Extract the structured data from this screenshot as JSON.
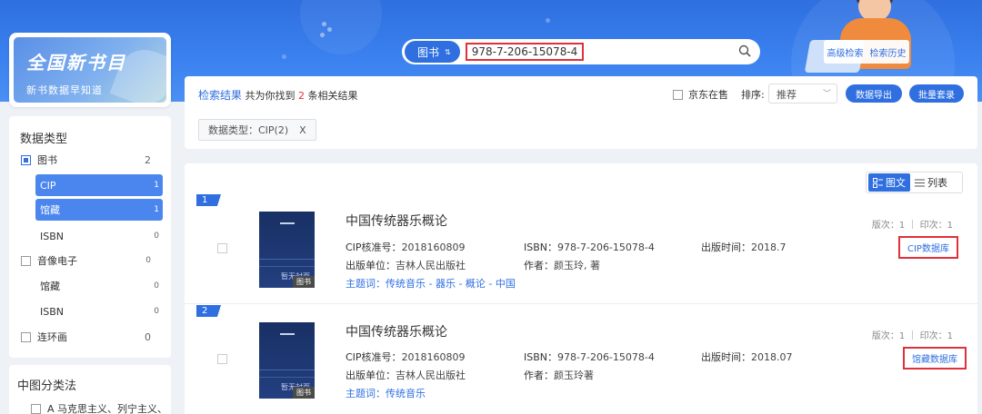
{
  "search": {
    "type_label": "图书",
    "type_arrows": "⇅",
    "query": "978-7-206-15078-4"
  },
  "top_links": {
    "advanced": "高级检索",
    "history": "检索历史"
  },
  "brand": {
    "title": "全国新书目",
    "subtitle": "新书数据早知道"
  },
  "data_type": {
    "heading": "数据类型",
    "rows": [
      {
        "label": "图书",
        "count": "2"
      },
      {
        "label": "CIP",
        "count": "1"
      },
      {
        "label": "馆藏",
        "count": "1"
      },
      {
        "label": "ISBN",
        "count": "0"
      },
      {
        "label": "音像电子",
        "count": "0"
      },
      {
        "label": "馆藏",
        "count": "0"
      },
      {
        "label": "ISBN",
        "count": "0"
      },
      {
        "label": "连环画",
        "count": "0"
      }
    ]
  },
  "classification": {
    "heading": "中图分类法",
    "first_item": "A 马克思主义、列宁主义、"
  },
  "results_header": {
    "title": "检索结果",
    "prefix": "共为你找到",
    "count": "2",
    "suffix": "条相关结果",
    "jd_label": "京东在售",
    "sort_label": "排序:",
    "sort_value": "推荐",
    "export_btn": "数据导出",
    "batch_btn": "批量套录",
    "filter_chip": "数据类型：CIP(2)",
    "filter_close": "X"
  },
  "view_toggle": {
    "grid": "图文",
    "list": "列表"
  },
  "results": [
    {
      "index": "1",
      "title": "中国传统器乐概论",
      "cip_label": "CIP核准号：",
      "cip": "2018160809",
      "isbn_label": "ISBN：",
      "isbn": "978-7-206-15078-4",
      "pubdate_label": "出版时间：",
      "pubdate": "2018.7",
      "publisher_label": "出版单位：",
      "publisher": "吉林人民出版社",
      "author_label": "作者：",
      "author": "颜玉玲, 著",
      "subject_label": "主题词：",
      "subject": "传统音乐 - 器乐 - 概论 - 中国",
      "edition": "版次：1 ｜ 印次：1",
      "source": "CIP数据库",
      "cover_text": "暂无封面",
      "cover_tag": "图书"
    },
    {
      "index": "2",
      "title": "中国传统器乐概论",
      "cip_label": "CIP核准号：",
      "cip": "2018160809",
      "isbn_label": "ISBN：",
      "isbn": "978-7-206-15078-4",
      "pubdate_label": "出版时间：",
      "pubdate": "2018.07",
      "publisher_label": "出版单位：",
      "publisher": "吉林人民出版社",
      "author_label": "作者：",
      "author": "颜玉玲著",
      "subject_label": "主题词：",
      "subject": "传统音乐",
      "edition": "版次：1 ｜ 印次：1",
      "source": "馆藏数据库",
      "cover_text": "暂无封面",
      "cover_tag": "图书"
    }
  ],
  "colors": {
    "primary": "#2f6fe0",
    "highlight_box": "#e0303a",
    "active_row": "#4a86ee"
  }
}
